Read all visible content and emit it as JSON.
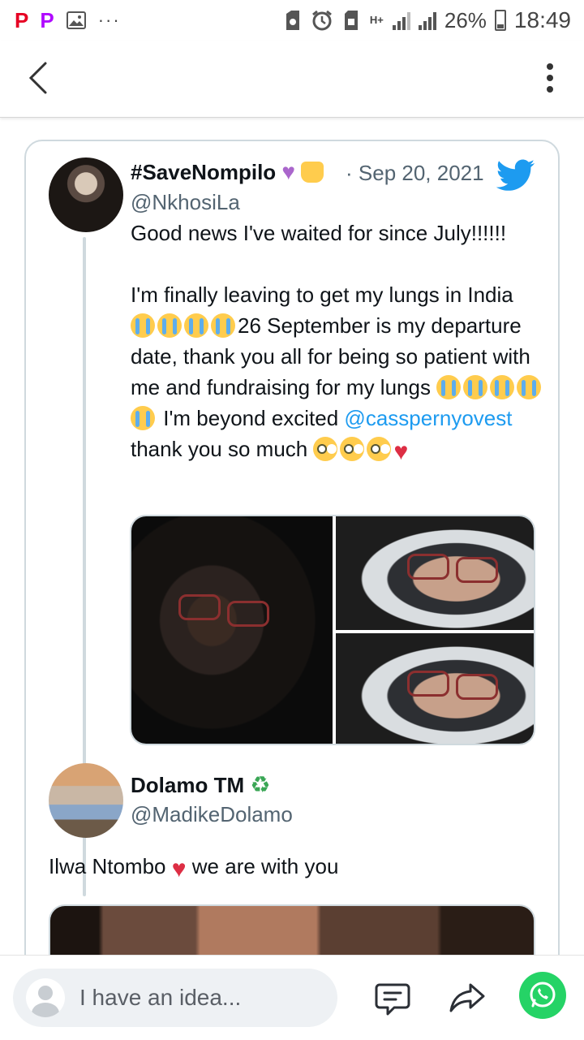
{
  "status_bar": {
    "battery": "26%",
    "time": "18:49",
    "network": "H+"
  },
  "tweet": {
    "display_name": "#SaveNompilo",
    "handle": "@NkhosiLa",
    "date": "Sep 20, 2021",
    "separator": "·",
    "text_line1": "Good news I've waited for since July!!!!!!",
    "text_p2_a": "I'm finally leaving to get my lungs in India ",
    "text_p2_b": "26 September is my departure date, thank you all for being so patient with me and fundraising for my lungs ",
    "text_p2_c": " I'm beyond excited ",
    "mention": "@casspernyovest",
    "text_p2_d": " thank you so much "
  },
  "reply": {
    "display_name": "Dolamo TM",
    "handle": "@MadikeDolamo",
    "text_a": "Ilwa Ntombo ",
    "text_b": " we are with you"
  },
  "bottom_bar": {
    "placeholder": "I have an idea..."
  },
  "icons": [
    "back-arrow-icon",
    "more-vert-icon",
    "twitter-bird-icon",
    "crying-face-emoji",
    "pleading-face-emoji",
    "red-heart-emoji",
    "purple-heart-emoji",
    "raising-hands-emoji",
    "recycle-emoji",
    "comment-icon",
    "share-icon",
    "whatsapp-icon"
  ],
  "colors": {
    "link": "#1d9bf0",
    "twitter_blue": "#1d9bf0",
    "whatsapp": "#25d366",
    "heart": "#dd2e44"
  }
}
